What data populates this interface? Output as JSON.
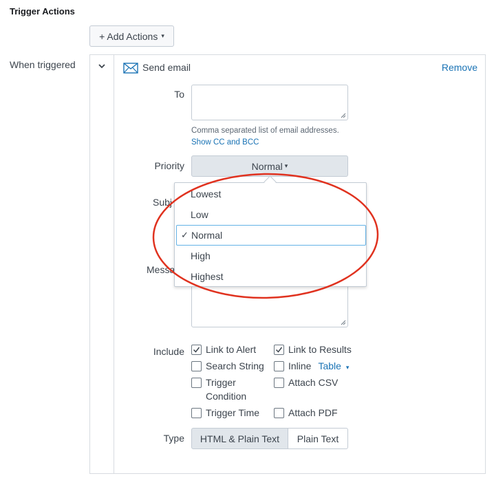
{
  "section_title": "Trigger Actions",
  "add_actions": {
    "label": "+ Add Actions",
    "caret": "▾"
  },
  "when_triggered_label": "When triggered",
  "action": {
    "icon": "envelope-icon",
    "title": "Send email",
    "remove_label": "Remove"
  },
  "to": {
    "label": "To",
    "value": "",
    "help": "Comma separated list of email addresses.",
    "show_cc": "Show CC and BCC"
  },
  "priority": {
    "label": "Priority",
    "selected": "Normal",
    "caret": "▾",
    "options": [
      "Lowest",
      "Low",
      "Normal",
      "High",
      "Highest"
    ],
    "selected_index": 2,
    "checkmark": "✓"
  },
  "subject": {
    "label_visible": "Subj"
  },
  "message": {
    "label_visible": "Messa"
  },
  "include": {
    "label": "Include",
    "options": [
      {
        "label": "Link to Alert",
        "checked": true
      },
      {
        "label": "Link to Results",
        "checked": true
      },
      {
        "label": "Search String",
        "checked": false
      },
      {
        "label": "Inline",
        "checked": false
      },
      {
        "label": "Trigger Condition",
        "checked": false
      },
      {
        "label": "Attach CSV",
        "checked": false
      },
      {
        "label": "Trigger Time",
        "checked": false
      },
      {
        "label": "Attach PDF",
        "checked": false
      }
    ],
    "inline_format": "Table",
    "inline_format_caret": "▾",
    "trigger_condition_lines": [
      "Trigger",
      "Condition"
    ]
  },
  "type": {
    "label": "Type",
    "options": [
      "HTML & Plain Text",
      "Plain Text"
    ],
    "selected": "HTML & Plain Text"
  },
  "colors": {
    "link": "#1a73b5",
    "annotation": "#e0321f",
    "selected_border": "#63b2e6",
    "button_bg": "#e1e6eb"
  }
}
